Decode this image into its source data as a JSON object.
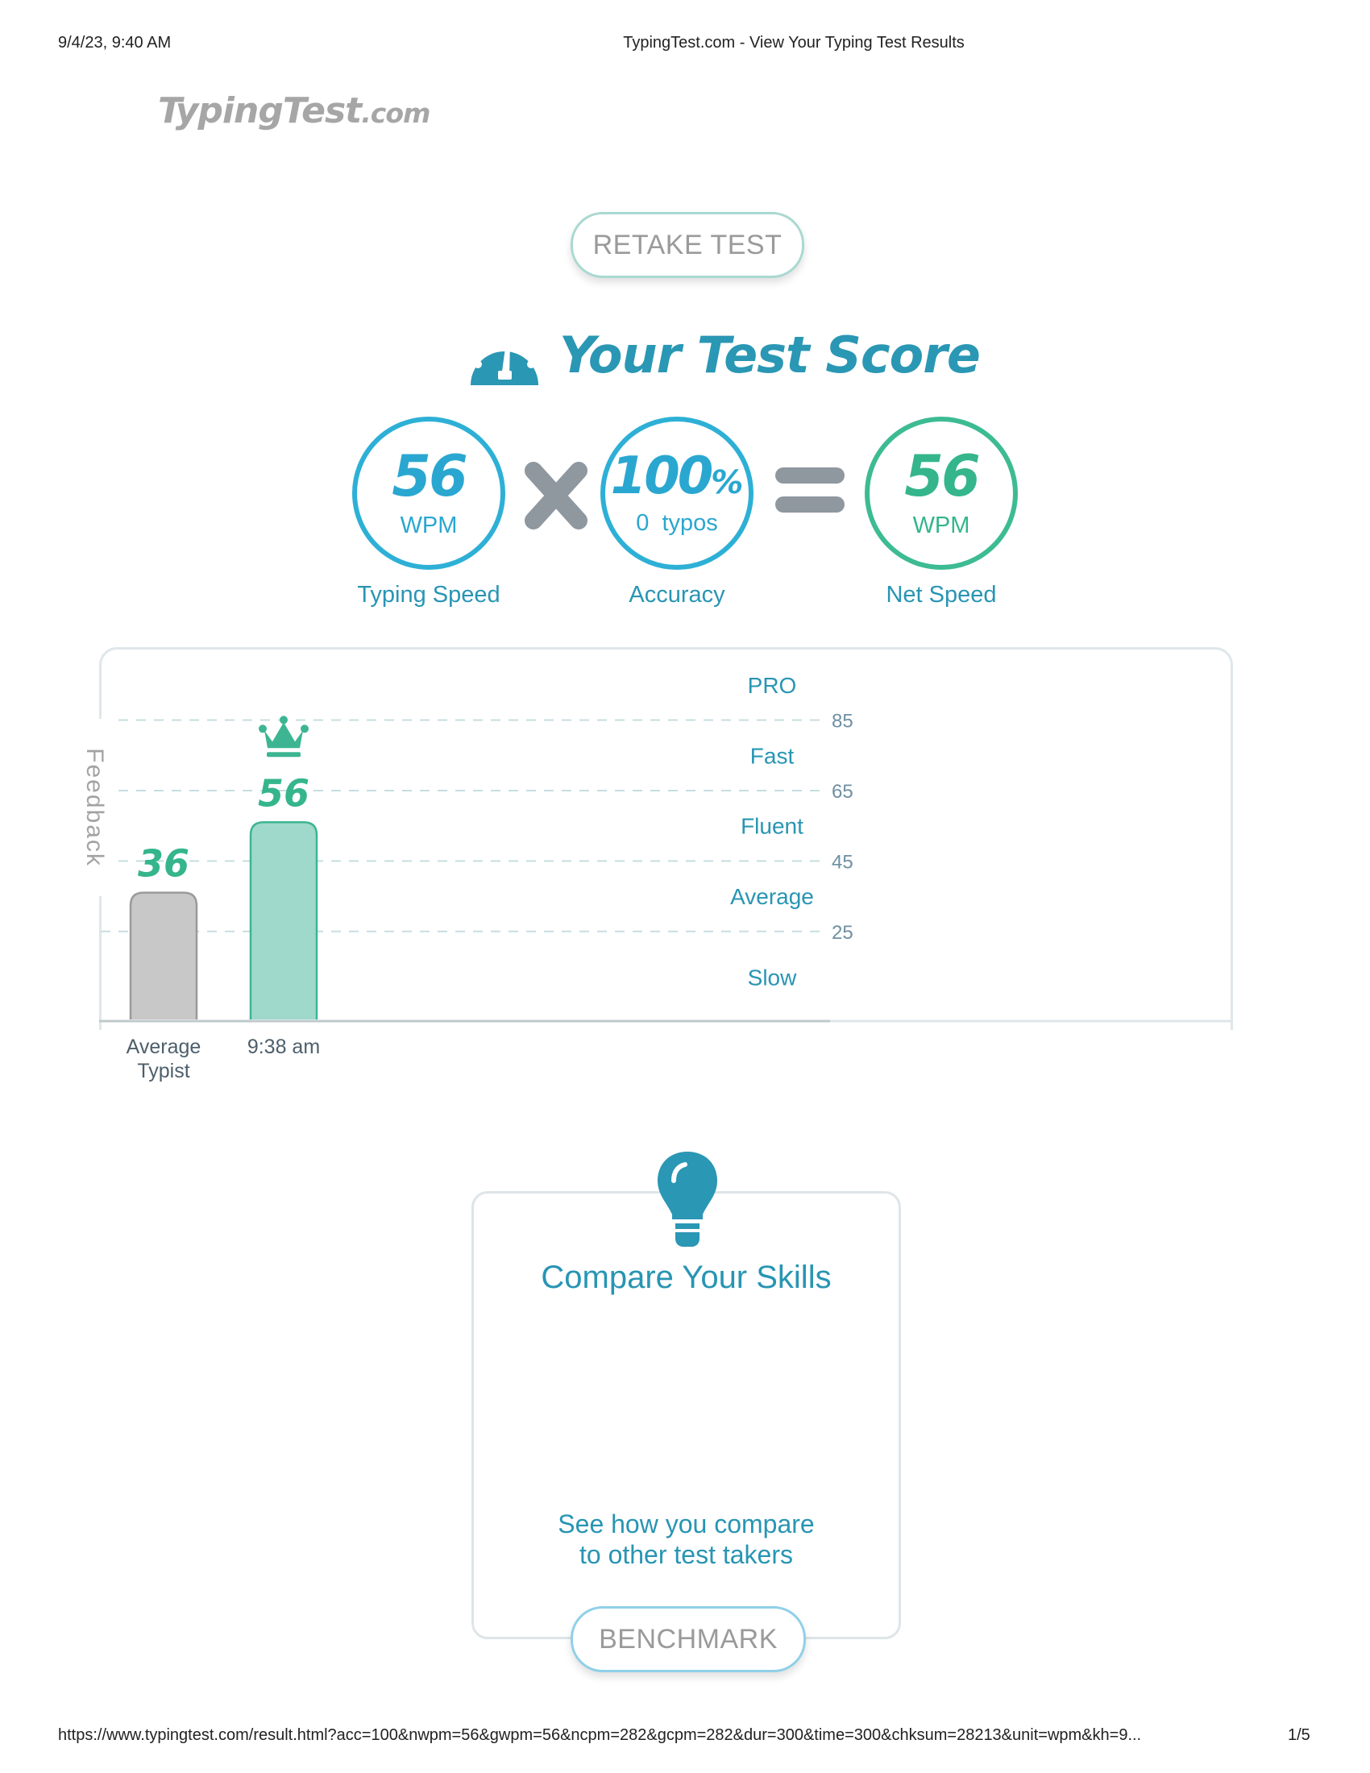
{
  "print_header": {
    "date": "9/4/23, 9:40 AM",
    "title": "TypingTest.com - View Your Typing Test Results"
  },
  "logo": {
    "name": "TypingTest",
    "suffix": ".com"
  },
  "buttons": {
    "retake": "RETAKE TEST",
    "benchmark": "BENCHMARK"
  },
  "score": {
    "title": "Your Test Score",
    "icon": "speedometer-icon",
    "typing_speed": {
      "value": "56",
      "unit": "WPM",
      "label": "Typing Speed"
    },
    "operator_1": "times-icon",
    "accuracy": {
      "value": "100",
      "suffix": "%",
      "detail": "0  typos",
      "label": "Accuracy"
    },
    "operator_2": "equals-icon",
    "net_speed": {
      "value": "56",
      "unit": "WPM",
      "label": "Net Speed"
    }
  },
  "feedback_tab": "Feedback",
  "chart_data": {
    "type": "bar",
    "categories": [
      "Average Typist",
      "9:38 am"
    ],
    "category_lines": [
      [
        "Average",
        "Typist"
      ],
      [
        "9:38 am"
      ]
    ],
    "values": [
      36,
      56
    ],
    "value_labels": [
      "36",
      "56"
    ],
    "bar_colors": {
      "fill": [
        "#c8c8c8",
        "#9fd9cb"
      ],
      "stroke": [
        "#9a9a9a",
        "#3db592"
      ]
    },
    "highlight_index": 1,
    "highlight_icon": "crown-icon",
    "y_ticks": [
      25,
      45,
      65,
      85
    ],
    "ylim": [
      0,
      100
    ],
    "zones": [
      {
        "label": "PRO",
        "center": 95
      },
      {
        "label": "Fast",
        "center": 75
      },
      {
        "label": "Fluent",
        "center": 55
      },
      {
        "label": "Average",
        "center": 35
      },
      {
        "label": "Slow",
        "center": 12
      }
    ],
    "grid": "dashed",
    "title": "",
    "xlabel": "",
    "ylabel": ""
  },
  "compare": {
    "icon": "lightbulb-icon",
    "title": "Compare Your Skills",
    "desc_line1": "See how you compare",
    "desc_line2": "to other test takers"
  },
  "print_footer": {
    "url": "https://www.typingtest.com/result.html?acc=100&nwpm=56&gwpm=56&ncpm=282&gcpm=282&dur=300&time=300&chksum=28213&unit=wpm&kh=9...",
    "page": "1/5"
  },
  "colors": {
    "brand_blue": "#2a97b4",
    "circle_blue": "#2eb0d6",
    "net_green": "#3dbb93",
    "operator_gray": "#8f979f"
  }
}
